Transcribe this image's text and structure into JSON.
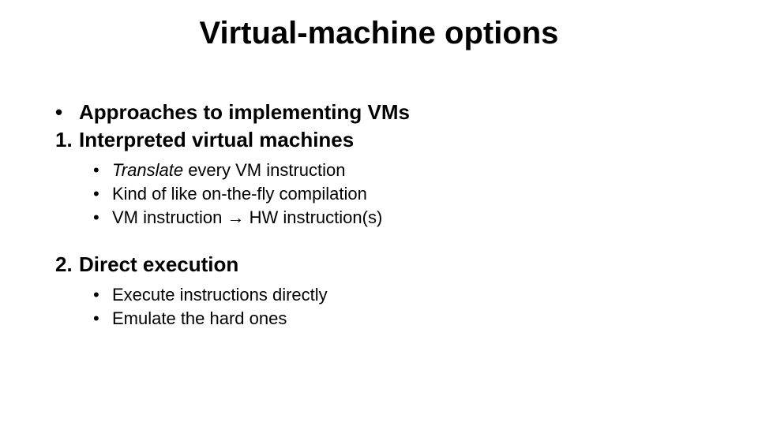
{
  "title": "Virtual-machine options",
  "approaches_label": "Approaches to implementing VMs",
  "section1": {
    "num": "1.",
    "heading": "Interpreted virtual machines",
    "sub": {
      "s1_prefix_italic": "Translate",
      "s1_rest": " every VM instruction",
      "s2": "Kind of like on-the-fly compilation",
      "s3": "VM instruction → HW instruction(s)"
    }
  },
  "section2": {
    "num": "2.",
    "heading": "Direct execution",
    "sub": {
      "s1": "Execute instructions directly",
      "s2": "Emulate the hard ones"
    }
  }
}
